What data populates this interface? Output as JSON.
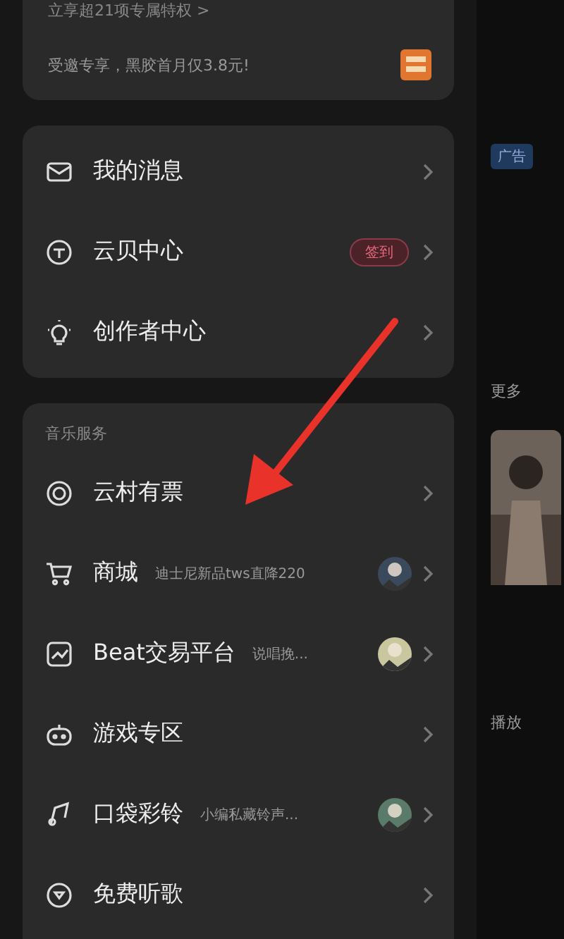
{
  "vip_card": {
    "perk_link": "立享超21项专属特权 >",
    "offer": "受邀专享，黑胶首月仅3.8元!"
  },
  "menu_group": {
    "items": [
      {
        "label": "我的消息"
      },
      {
        "label": "云贝中心",
        "badge": "签到"
      },
      {
        "label": "创作者中心"
      }
    ]
  },
  "music_services": {
    "title": "音乐服务",
    "items": [
      {
        "label": "云村有票"
      },
      {
        "label": "商城",
        "hint": "迪士尼新品tws直降220"
      },
      {
        "label": "Beat交易平台",
        "hint": "说唱挽..."
      },
      {
        "label": "游戏专区"
      },
      {
        "label": "口袋彩铃",
        "hint": "小编私藏铃声..."
      },
      {
        "label": "免费听歌"
      }
    ]
  },
  "background_page": {
    "ad_tag": "广告",
    "more_link": "更多",
    "play_label": "播放"
  },
  "annotation_arrow": true
}
